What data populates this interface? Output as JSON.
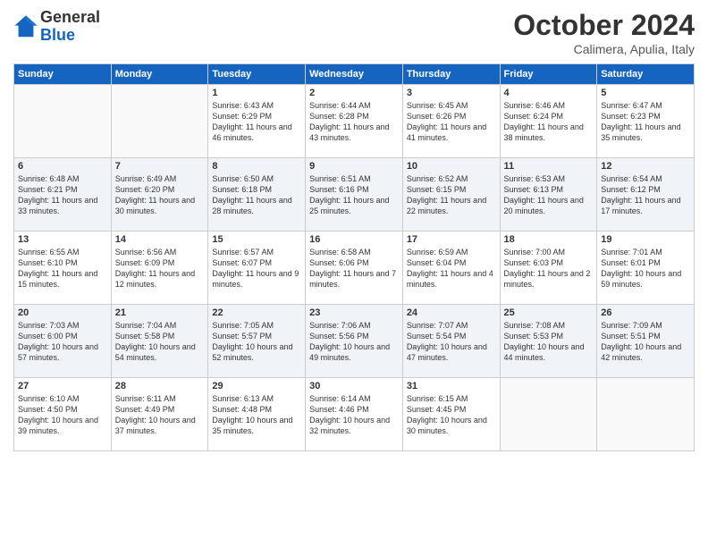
{
  "header": {
    "logo_line1": "General",
    "logo_line2": "Blue",
    "month_year": "October 2024",
    "location": "Calimera, Apulia, Italy"
  },
  "days_of_week": [
    "Sunday",
    "Monday",
    "Tuesday",
    "Wednesday",
    "Thursday",
    "Friday",
    "Saturday"
  ],
  "weeks": [
    [
      {
        "day": "",
        "content": ""
      },
      {
        "day": "",
        "content": ""
      },
      {
        "day": "1",
        "content": "Sunrise: 6:43 AM\nSunset: 6:29 PM\nDaylight: 11 hours and 46 minutes."
      },
      {
        "day": "2",
        "content": "Sunrise: 6:44 AM\nSunset: 6:28 PM\nDaylight: 11 hours and 43 minutes."
      },
      {
        "day": "3",
        "content": "Sunrise: 6:45 AM\nSunset: 6:26 PM\nDaylight: 11 hours and 41 minutes."
      },
      {
        "day": "4",
        "content": "Sunrise: 6:46 AM\nSunset: 6:24 PM\nDaylight: 11 hours and 38 minutes."
      },
      {
        "day": "5",
        "content": "Sunrise: 6:47 AM\nSunset: 6:23 PM\nDaylight: 11 hours and 35 minutes."
      }
    ],
    [
      {
        "day": "6",
        "content": "Sunrise: 6:48 AM\nSunset: 6:21 PM\nDaylight: 11 hours and 33 minutes."
      },
      {
        "day": "7",
        "content": "Sunrise: 6:49 AM\nSunset: 6:20 PM\nDaylight: 11 hours and 30 minutes."
      },
      {
        "day": "8",
        "content": "Sunrise: 6:50 AM\nSunset: 6:18 PM\nDaylight: 11 hours and 28 minutes."
      },
      {
        "day": "9",
        "content": "Sunrise: 6:51 AM\nSunset: 6:16 PM\nDaylight: 11 hours and 25 minutes."
      },
      {
        "day": "10",
        "content": "Sunrise: 6:52 AM\nSunset: 6:15 PM\nDaylight: 11 hours and 22 minutes."
      },
      {
        "day": "11",
        "content": "Sunrise: 6:53 AM\nSunset: 6:13 PM\nDaylight: 11 hours and 20 minutes."
      },
      {
        "day": "12",
        "content": "Sunrise: 6:54 AM\nSunset: 6:12 PM\nDaylight: 11 hours and 17 minutes."
      }
    ],
    [
      {
        "day": "13",
        "content": "Sunrise: 6:55 AM\nSunset: 6:10 PM\nDaylight: 11 hours and 15 minutes."
      },
      {
        "day": "14",
        "content": "Sunrise: 6:56 AM\nSunset: 6:09 PM\nDaylight: 11 hours and 12 minutes."
      },
      {
        "day": "15",
        "content": "Sunrise: 6:57 AM\nSunset: 6:07 PM\nDaylight: 11 hours and 9 minutes."
      },
      {
        "day": "16",
        "content": "Sunrise: 6:58 AM\nSunset: 6:06 PM\nDaylight: 11 hours and 7 minutes."
      },
      {
        "day": "17",
        "content": "Sunrise: 6:59 AM\nSunset: 6:04 PM\nDaylight: 11 hours and 4 minutes."
      },
      {
        "day": "18",
        "content": "Sunrise: 7:00 AM\nSunset: 6:03 PM\nDaylight: 11 hours and 2 minutes."
      },
      {
        "day": "19",
        "content": "Sunrise: 7:01 AM\nSunset: 6:01 PM\nDaylight: 10 hours and 59 minutes."
      }
    ],
    [
      {
        "day": "20",
        "content": "Sunrise: 7:03 AM\nSunset: 6:00 PM\nDaylight: 10 hours and 57 minutes."
      },
      {
        "day": "21",
        "content": "Sunrise: 7:04 AM\nSunset: 5:58 PM\nDaylight: 10 hours and 54 minutes."
      },
      {
        "day": "22",
        "content": "Sunrise: 7:05 AM\nSunset: 5:57 PM\nDaylight: 10 hours and 52 minutes."
      },
      {
        "day": "23",
        "content": "Sunrise: 7:06 AM\nSunset: 5:56 PM\nDaylight: 10 hours and 49 minutes."
      },
      {
        "day": "24",
        "content": "Sunrise: 7:07 AM\nSunset: 5:54 PM\nDaylight: 10 hours and 47 minutes."
      },
      {
        "day": "25",
        "content": "Sunrise: 7:08 AM\nSunset: 5:53 PM\nDaylight: 10 hours and 44 minutes."
      },
      {
        "day": "26",
        "content": "Sunrise: 7:09 AM\nSunset: 5:51 PM\nDaylight: 10 hours and 42 minutes."
      }
    ],
    [
      {
        "day": "27",
        "content": "Sunrise: 6:10 AM\nSunset: 4:50 PM\nDaylight: 10 hours and 39 minutes."
      },
      {
        "day": "28",
        "content": "Sunrise: 6:11 AM\nSunset: 4:49 PM\nDaylight: 10 hours and 37 minutes."
      },
      {
        "day": "29",
        "content": "Sunrise: 6:13 AM\nSunset: 4:48 PM\nDaylight: 10 hours and 35 minutes."
      },
      {
        "day": "30",
        "content": "Sunrise: 6:14 AM\nSunset: 4:46 PM\nDaylight: 10 hours and 32 minutes."
      },
      {
        "day": "31",
        "content": "Sunrise: 6:15 AM\nSunset: 4:45 PM\nDaylight: 10 hours and 30 minutes."
      },
      {
        "day": "",
        "content": ""
      },
      {
        "day": "",
        "content": ""
      }
    ]
  ]
}
